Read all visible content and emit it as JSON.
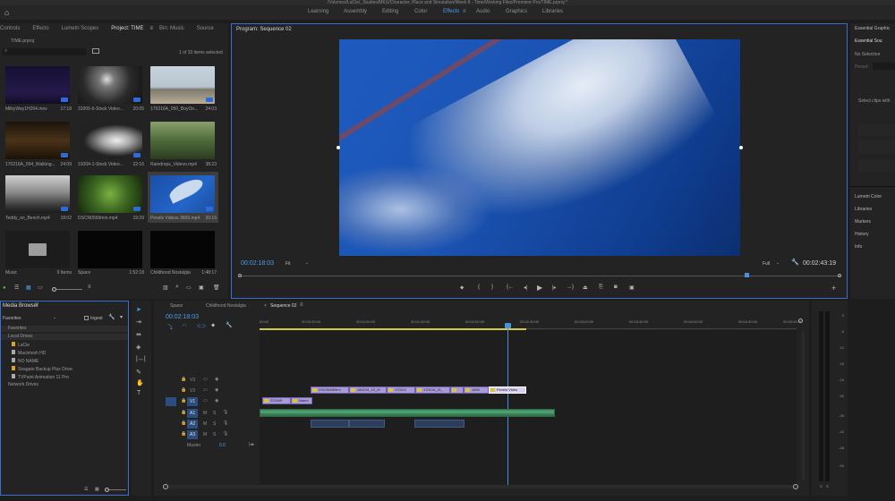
{
  "window": {
    "title": "/Volumes/LaCie/_Studies/MKU/Character, Place and Simulation/Week 8 - Time/Working Files/Premiere Pro/TIME.prproj *"
  },
  "workspaces": [
    "Learning",
    "Assembly",
    "Editing",
    "Color",
    "Effects",
    "Audio",
    "Graphics",
    "Libraries"
  ],
  "workspace_active_index": 4,
  "project_panel": {
    "tabs": [
      "Controls",
      "Effects",
      "Lumetri Scopes",
      "Project: TIME",
      "Bin: Music",
      "Source"
    ],
    "active_tab_index": 3,
    "file_name": "TIME.prproj",
    "item_count": "1 of 33 items selected",
    "search_placeholder": "",
    "items": [
      {
        "name": "MilkyWay1H264.mov",
        "duration": "17:18"
      },
      {
        "name": "31005-6-Stock Video...",
        "duration": "20:05"
      },
      {
        "name": "170216A_050_BoyOn...",
        "duration": "24:03"
      },
      {
        "name": "170216A_094_Walking...",
        "duration": "24:09"
      },
      {
        "name": "31004-1-Stock Video...",
        "duration": "22:16"
      },
      {
        "name": "Raindrops_Videvo.mp4",
        "duration": "38:23"
      },
      {
        "name": "Teddy_on_Bench.mp4",
        "duration": "18:02"
      },
      {
        "name": "DSCN0569min.mp4",
        "duration": "19:29"
      },
      {
        "name": "Pexels Videos 3606.mp4",
        "duration": "20:19"
      },
      {
        "name": "Music",
        "duration": "9 Items"
      },
      {
        "name": "Space",
        "duration": "1:52:18"
      },
      {
        "name": "Childhood Nostalgia",
        "duration": "1:48:17"
      }
    ]
  },
  "program_monitor": {
    "title": "Program: Sequence 02",
    "timecode_left": "00:02:18:03",
    "fit": "Fit",
    "quality": "Full",
    "timecode_right": "00:02:43:19"
  },
  "right_panel": {
    "tabs": [
      "Essential Graphic"
    ],
    "subtab": "Essential Sou",
    "no_selection": "No Selection",
    "preset": "Preset:",
    "hint": "Select clips with",
    "links": [
      "Lumetri Color",
      "Libraries",
      "Markers",
      "History",
      "Info"
    ]
  },
  "media_browser": {
    "title": "Media Browser",
    "favorites_select": "Favorites",
    "ingest": "Ingest",
    "tree": [
      {
        "label": "Favorites",
        "level": 0
      },
      {
        "label": "Local Drives",
        "level": 0
      },
      {
        "label": "LaCie",
        "level": 1
      },
      {
        "label": "Macintosh HD",
        "level": 1
      },
      {
        "label": "NO NAME",
        "level": 1
      },
      {
        "label": "Seagate Backup Plus Drive",
        "level": 1
      },
      {
        "label": "TVPaint Animation 11 Pro",
        "level": 1
      },
      {
        "label": "Network Drives",
        "level": 0
      }
    ]
  },
  "timeline": {
    "tabs": [
      "Space",
      "Childhood Nostalgia",
      "Sequence 02"
    ],
    "active_tab_index": 2,
    "timecode": "00:02:18:03",
    "ruler": [
      "00:00",
      "00:00:30:00",
      "00:01:00:00",
      "00:01:30:00",
      "00:02:00:00",
      "00:02:30:00",
      "00:03:00:00",
      "00:03:30:00",
      "00:04:00:00",
      "00:04:30:00",
      "00:05:00:00"
    ],
    "tracks": [
      {
        "id": "V3",
        "type": "video"
      },
      {
        "id": "V2",
        "type": "video"
      },
      {
        "id": "V1",
        "type": "video"
      },
      {
        "id": "A1",
        "type": "audio"
      },
      {
        "id": "A2",
        "type": "audio"
      },
      {
        "id": "A3",
        "type": "audio"
      }
    ],
    "master": {
      "label": "Master",
      "value": "0.0"
    },
    "clips_v2": [
      "DSCN0569mi",
      "180216_10_M",
      "170211",
      "170216_01_",
      "1800",
      "Pexels Video"
    ],
    "clips_v1": [
      "223449",
      "Nasro"
    ]
  },
  "audio_meter": {
    "scale": [
      "0",
      "-6",
      "-12",
      "-18",
      "-24",
      "-30",
      "-36",
      "-42",
      "-48",
      "-54"
    ],
    "bottom": [
      "S",
      "S"
    ]
  },
  "colors": {
    "accent": "#4a9ff0",
    "playhead": "#4a8fe0",
    "clip_video": "#a89bd8",
    "clip_audio": "#3f8a5e"
  }
}
